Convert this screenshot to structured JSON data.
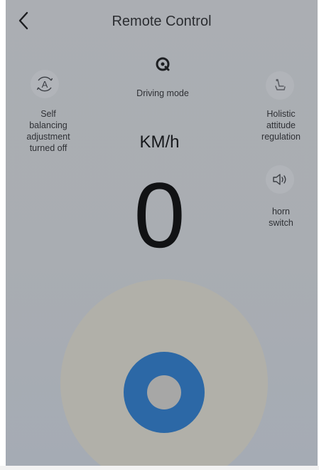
{
  "header": {
    "title": "Remote Control"
  },
  "controls": {
    "driving_mode": {
      "label": "Driving mode",
      "icon": "steering-wheel-icon"
    },
    "self_balancing": {
      "label_lines": [
        "Self",
        "balancing",
        "adjustment",
        "turned off"
      ],
      "icon": "auto-a-icon"
    },
    "holistic_attitude": {
      "label_lines": [
        "Holistic",
        "attitude",
        "regulation"
      ],
      "icon": "seat-icon"
    },
    "horn": {
      "label_lines": [
        "horn",
        "switch"
      ],
      "icon": "speaker-icon"
    }
  },
  "speed": {
    "unit": "KM/h",
    "value": "0"
  },
  "colors": {
    "accent": "#2c68a6",
    "overlay": "#abaeb3",
    "joystick_base": "#b1b0a9"
  }
}
